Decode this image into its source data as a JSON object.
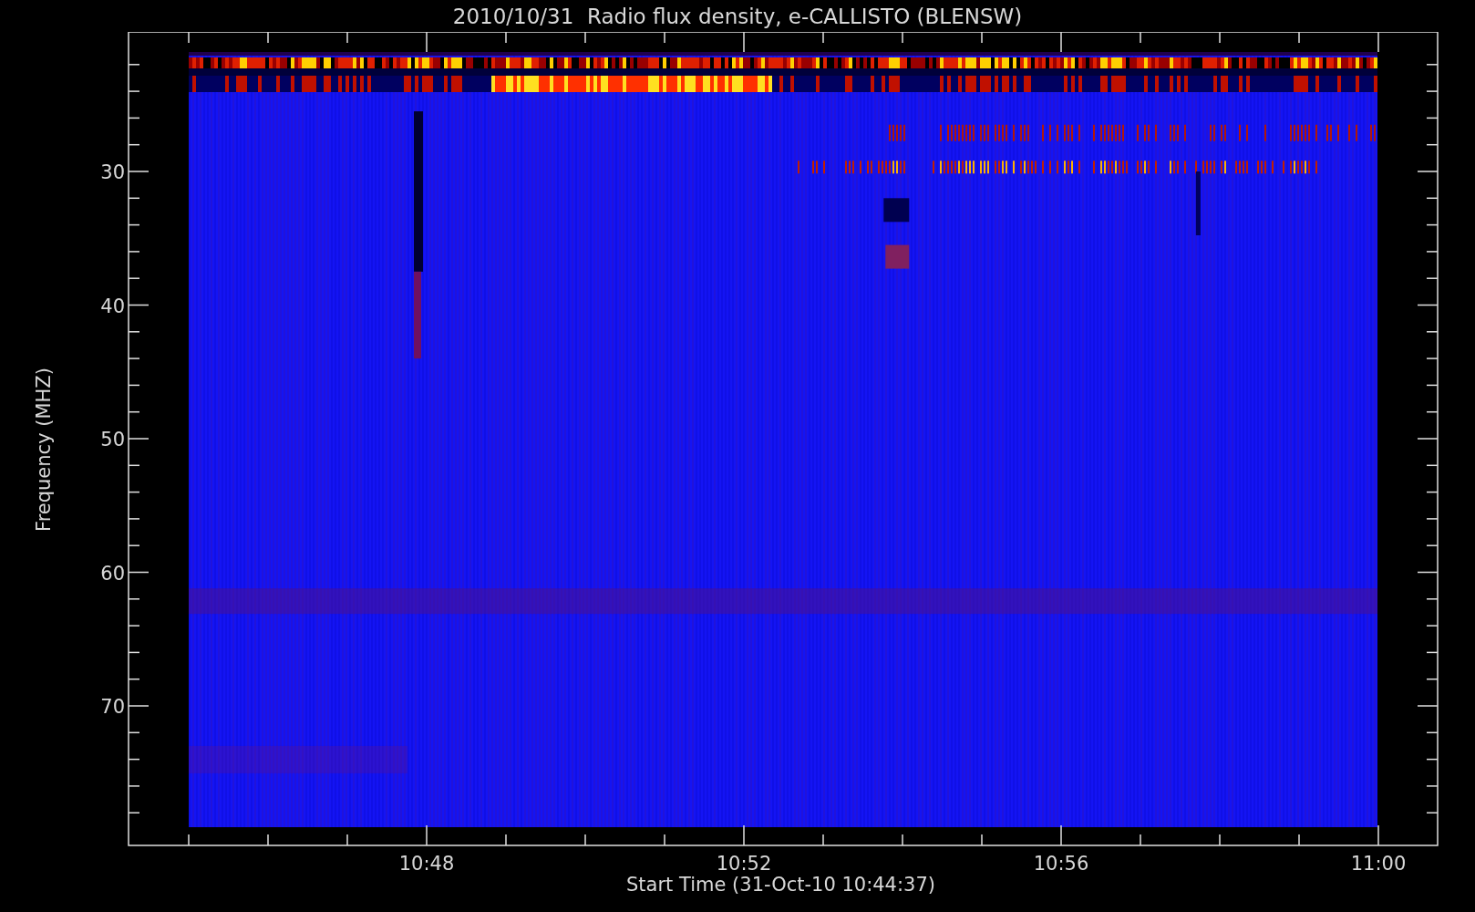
{
  "title": "2010/10/31  Radio flux density, e-CALLISTO (BLENSW)",
  "y_axis": {
    "label": "Frequency (MHZ)",
    "ticks": [
      "30",
      "40",
      "50",
      "60",
      "70"
    ]
  },
  "x_axis": {
    "label": "Start Time (31-Oct-10 10:44:37)",
    "ticks": [
      "10:48",
      "10:52",
      "10:56",
      "11:00"
    ]
  }
}
